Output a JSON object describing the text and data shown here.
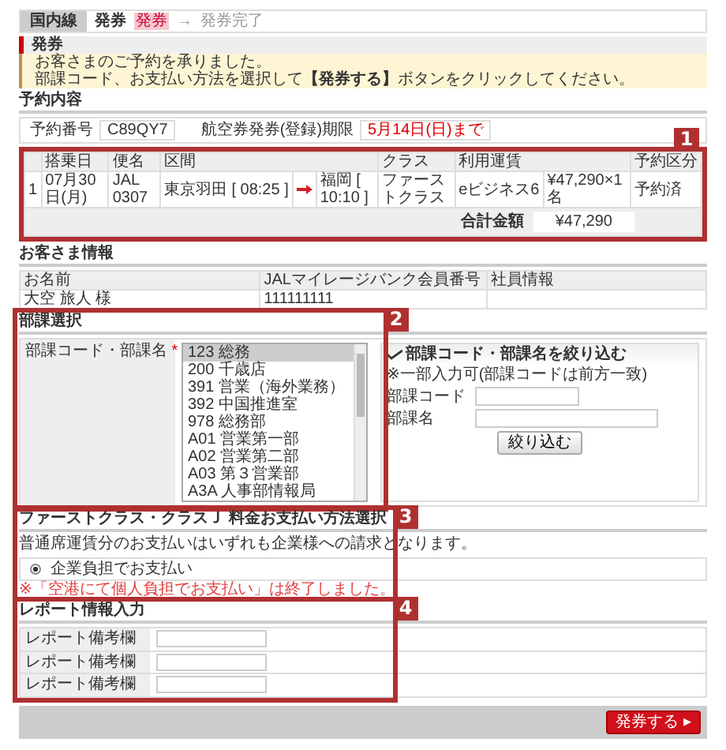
{
  "breadcrumb": {
    "category": "国内線",
    "title": "発券",
    "steps": [
      {
        "label": "発券",
        "selected": true
      },
      {
        "label": "発券完了",
        "selected": false
      }
    ],
    "separator": "→"
  },
  "notice": {
    "title": "発券",
    "lines": [
      "お客さまのご予約を承りました。",
      "部課コード、お支払い方法を選択して**【発券する】**ボタンをクリックしてください。"
    ]
  },
  "reservation": {
    "heading": "予約内容",
    "number_label": "予約番号",
    "number": "C89QY7",
    "deadline_label": "航空券発券(登録)期限",
    "deadline": "5月14日(日)まで",
    "callout": "1",
    "columns": [
      "搭乗日",
      "便名",
      "区間",
      "クラス",
      "利用運賃",
      "予約区分"
    ],
    "rows": [
      {
        "no": "1",
        "date": "07月30日(月)",
        "flight": "JAL 0307",
        "from": "東京羽田 [ 08:25 ]",
        "to": "福岡 [ 10:10 ]",
        "class": "ファーストクラス",
        "fare": "eビジネス6",
        "price": "¥47,290×1名",
        "status": "予約済"
      }
    ],
    "total_label": "合計金額",
    "total": "¥47,290"
  },
  "customer": {
    "heading": "お客さま情報",
    "columns": [
      "お名前",
      "JALマイレージバンク会員番号",
      "社員情報"
    ],
    "rows": [
      [
        "大空 旅人 様",
        "111111111"
      ]
    ]
  },
  "department": {
    "heading": "部課選択",
    "callout": "2",
    "label": "部課コード・部課名",
    "required_mark": "*",
    "options": [
      {
        "label": "123 総務",
        "selected": true
      },
      {
        "label": "200 千歳店",
        "selected": false
      },
      {
        "label": "391 営業（海外業務）",
        "selected": false
      },
      {
        "label": "392 中国推進室",
        "selected": false
      },
      {
        "label": "978 総務部",
        "selected": false
      },
      {
        "label": "A01 営業第一部",
        "selected": false
      },
      {
        "label": "A02 営業第二部",
        "selected": false
      },
      {
        "label": "A03 第３営業部",
        "selected": false
      },
      {
        "label": "A3A 人事部情報局",
        "selected": false
      }
    ],
    "filter": {
      "title": "部課コード・部課名を絞り込む",
      "hint": "※一部入力可(部課コードは前方一致)",
      "fields": [
        "部課コード",
        "部課名"
      ],
      "button": "絞り込む"
    }
  },
  "payment": {
    "heading": "ファーストクラス・クラスＪ 料金お支払い方法選択",
    "callout": "3",
    "description": "普通席運賃分のお支払いはいずれも企業様への請求となります。",
    "options": [
      {
        "label": "企業負担でお支払い",
        "selected": true
      }
    ],
    "note": "※「空港にて個人負担でお支払い」は終了しました。"
  },
  "report": {
    "heading": "レポート情報入力",
    "callout": "4",
    "fields": [
      "レポート備考欄",
      "レポート備考欄",
      "レポート備考欄"
    ]
  },
  "submit": {
    "label": "発券する",
    "icon": "▸"
  }
}
